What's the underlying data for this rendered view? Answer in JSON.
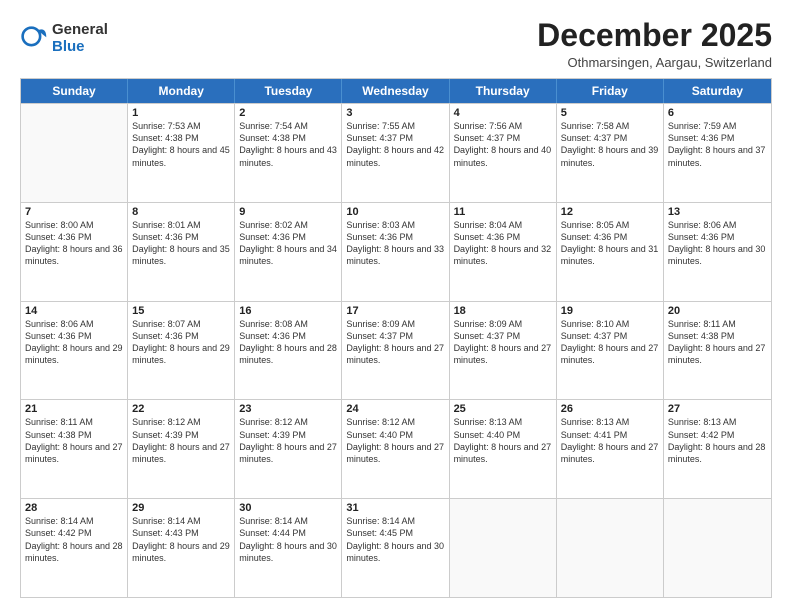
{
  "logo": {
    "general": "General",
    "blue": "Blue"
  },
  "title": "December 2025",
  "location": "Othmarsingen, Aargau, Switzerland",
  "days": [
    "Sunday",
    "Monday",
    "Tuesday",
    "Wednesday",
    "Thursday",
    "Friday",
    "Saturday"
  ],
  "weeks": [
    [
      {
        "day": "",
        "empty": true
      },
      {
        "day": "1",
        "sunrise": "7:53 AM",
        "sunset": "4:38 PM",
        "daylight": "8 hours and 45 minutes."
      },
      {
        "day": "2",
        "sunrise": "7:54 AM",
        "sunset": "4:38 PM",
        "daylight": "8 hours and 43 minutes."
      },
      {
        "day": "3",
        "sunrise": "7:55 AM",
        "sunset": "4:37 PM",
        "daylight": "8 hours and 42 minutes."
      },
      {
        "day": "4",
        "sunrise": "7:56 AM",
        "sunset": "4:37 PM",
        "daylight": "8 hours and 40 minutes."
      },
      {
        "day": "5",
        "sunrise": "7:58 AM",
        "sunset": "4:37 PM",
        "daylight": "8 hours and 39 minutes."
      },
      {
        "day": "6",
        "sunrise": "7:59 AM",
        "sunset": "4:36 PM",
        "daylight": "8 hours and 37 minutes."
      }
    ],
    [
      {
        "day": "7",
        "sunrise": "8:00 AM",
        "sunset": "4:36 PM",
        "daylight": "8 hours and 36 minutes."
      },
      {
        "day": "8",
        "sunrise": "8:01 AM",
        "sunset": "4:36 PM",
        "daylight": "8 hours and 35 minutes."
      },
      {
        "day": "9",
        "sunrise": "8:02 AM",
        "sunset": "4:36 PM",
        "daylight": "8 hours and 34 minutes."
      },
      {
        "day": "10",
        "sunrise": "8:03 AM",
        "sunset": "4:36 PM",
        "daylight": "8 hours and 33 minutes."
      },
      {
        "day": "11",
        "sunrise": "8:04 AM",
        "sunset": "4:36 PM",
        "daylight": "8 hours and 32 minutes."
      },
      {
        "day": "12",
        "sunrise": "8:05 AM",
        "sunset": "4:36 PM",
        "daylight": "8 hours and 31 minutes."
      },
      {
        "day": "13",
        "sunrise": "8:06 AM",
        "sunset": "4:36 PM",
        "daylight": "8 hours and 30 minutes."
      }
    ],
    [
      {
        "day": "14",
        "sunrise": "8:06 AM",
        "sunset": "4:36 PM",
        "daylight": "8 hours and 29 minutes."
      },
      {
        "day": "15",
        "sunrise": "8:07 AM",
        "sunset": "4:36 PM",
        "daylight": "8 hours and 29 minutes."
      },
      {
        "day": "16",
        "sunrise": "8:08 AM",
        "sunset": "4:36 PM",
        "daylight": "8 hours and 28 minutes."
      },
      {
        "day": "17",
        "sunrise": "8:09 AM",
        "sunset": "4:37 PM",
        "daylight": "8 hours and 27 minutes."
      },
      {
        "day": "18",
        "sunrise": "8:09 AM",
        "sunset": "4:37 PM",
        "daylight": "8 hours and 27 minutes."
      },
      {
        "day": "19",
        "sunrise": "8:10 AM",
        "sunset": "4:37 PM",
        "daylight": "8 hours and 27 minutes."
      },
      {
        "day": "20",
        "sunrise": "8:11 AM",
        "sunset": "4:38 PM",
        "daylight": "8 hours and 27 minutes."
      }
    ],
    [
      {
        "day": "21",
        "sunrise": "8:11 AM",
        "sunset": "4:38 PM",
        "daylight": "8 hours and 27 minutes."
      },
      {
        "day": "22",
        "sunrise": "8:12 AM",
        "sunset": "4:39 PM",
        "daylight": "8 hours and 27 minutes."
      },
      {
        "day": "23",
        "sunrise": "8:12 AM",
        "sunset": "4:39 PM",
        "daylight": "8 hours and 27 minutes."
      },
      {
        "day": "24",
        "sunrise": "8:12 AM",
        "sunset": "4:40 PM",
        "daylight": "8 hours and 27 minutes."
      },
      {
        "day": "25",
        "sunrise": "8:13 AM",
        "sunset": "4:40 PM",
        "daylight": "8 hours and 27 minutes."
      },
      {
        "day": "26",
        "sunrise": "8:13 AM",
        "sunset": "4:41 PM",
        "daylight": "8 hours and 27 minutes."
      },
      {
        "day": "27",
        "sunrise": "8:13 AM",
        "sunset": "4:42 PM",
        "daylight": "8 hours and 28 minutes."
      }
    ],
    [
      {
        "day": "28",
        "sunrise": "8:14 AM",
        "sunset": "4:42 PM",
        "daylight": "8 hours and 28 minutes."
      },
      {
        "day": "29",
        "sunrise": "8:14 AM",
        "sunset": "4:43 PM",
        "daylight": "8 hours and 29 minutes."
      },
      {
        "day": "30",
        "sunrise": "8:14 AM",
        "sunset": "4:44 PM",
        "daylight": "8 hours and 30 minutes."
      },
      {
        "day": "31",
        "sunrise": "8:14 AM",
        "sunset": "4:45 PM",
        "daylight": "8 hours and 30 minutes."
      },
      {
        "day": "",
        "empty": true
      },
      {
        "day": "",
        "empty": true
      },
      {
        "day": "",
        "empty": true
      }
    ]
  ]
}
